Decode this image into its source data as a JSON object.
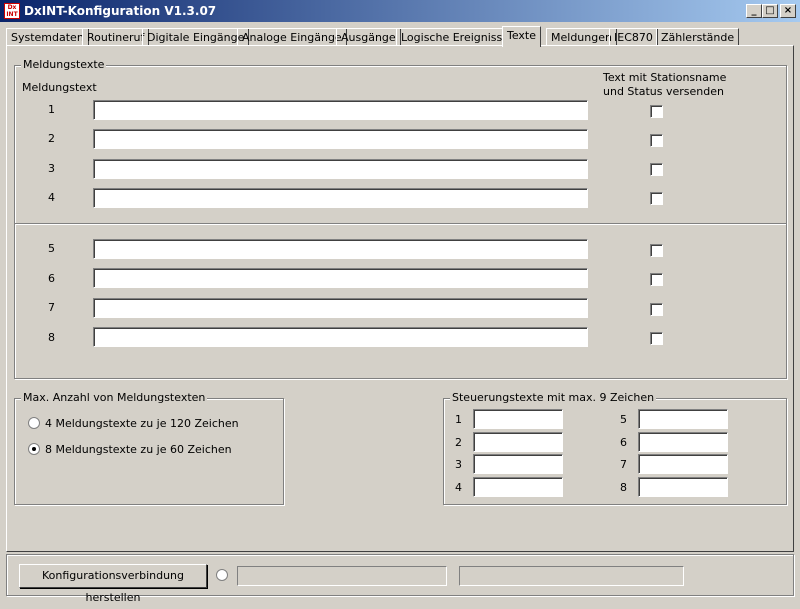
{
  "window": {
    "title": "DxINT-Konfiguration V1.3.07",
    "icon_text": "Dx INT",
    "min_label": "_",
    "max_label": "□",
    "close_label": "×"
  },
  "tabs": [
    {
      "label": "Systemdaten"
    },
    {
      "label": "Routineruf"
    },
    {
      "label": "Digitale Eingänge"
    },
    {
      "label": "Analoge Eingänge"
    },
    {
      "label": "Ausgänge"
    },
    {
      "label": "Logische Ereignisse"
    },
    {
      "label": "Texte",
      "active": true
    },
    {
      "label": "Meldungen"
    },
    {
      "label": "IEC870"
    },
    {
      "label": "Zählerstände"
    }
  ],
  "meldungstexte": {
    "legend": "Meldungstexte",
    "column_label": "Meldungstext",
    "checkbox_header_line1": "Text mit Stationsname",
    "checkbox_header_line2": "und Status versenden",
    "rows": [
      {
        "num": "1",
        "value": "",
        "checked": false
      },
      {
        "num": "2",
        "value": "",
        "checked": false
      },
      {
        "num": "3",
        "value": "",
        "checked": false
      },
      {
        "num": "4",
        "value": "",
        "checked": false
      },
      {
        "num": "5",
        "value": "",
        "checked": false
      },
      {
        "num": "6",
        "value": "",
        "checked": false
      },
      {
        "num": "7",
        "value": "",
        "checked": false
      },
      {
        "num": "8",
        "value": "",
        "checked": false
      }
    ]
  },
  "max_anzahl": {
    "legend": "Max. Anzahl von Meldungstexten",
    "options": [
      {
        "label": "4 Meldungstexte zu je 120 Zeichen",
        "selected": false
      },
      {
        "label": "8 Meldungstexte zu je 60 Zeichen",
        "selected": true
      }
    ]
  },
  "steuerung": {
    "legend": "Steuerungstexte mit max. 9 Zeichen",
    "left": [
      {
        "num": "1",
        "value": ""
      },
      {
        "num": "2",
        "value": ""
      },
      {
        "num": "3",
        "value": ""
      },
      {
        "num": "4",
        "value": ""
      }
    ],
    "right": [
      {
        "num": "5",
        "value": ""
      },
      {
        "num": "6",
        "value": ""
      },
      {
        "num": "7",
        "value": ""
      },
      {
        "num": "8",
        "value": ""
      }
    ]
  },
  "footer": {
    "connect_label": "Konfigurationsverbindung herstellen",
    "status1": "",
    "status2": ""
  }
}
